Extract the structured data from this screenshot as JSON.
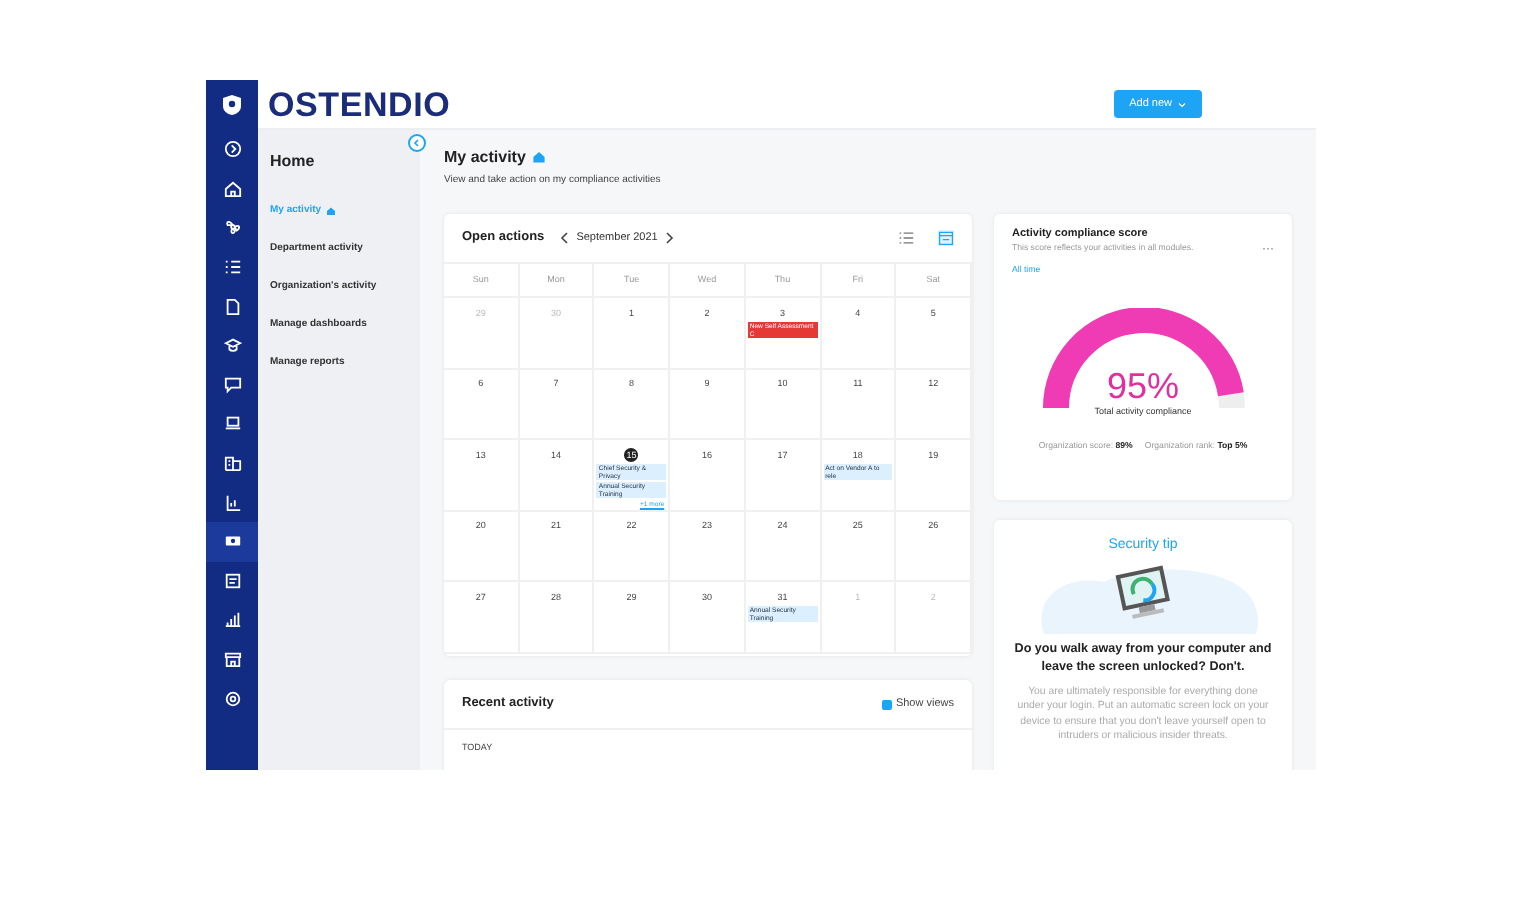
{
  "header": {
    "logo": "OSTENDIO",
    "add_button": "Add new"
  },
  "rail": [
    {
      "selected": false
    },
    {
      "selected": false
    },
    {
      "selected": false
    },
    {
      "selected": false
    },
    {
      "selected": false
    },
    {
      "selected": false
    },
    {
      "selected": false
    },
    {
      "selected": false
    },
    {
      "selected": false
    },
    {
      "selected": false
    },
    {
      "selected": true
    },
    {
      "selected": false
    },
    {
      "selected": false
    },
    {
      "selected": false
    },
    {
      "selected": false
    }
  ],
  "subnav": {
    "title": "Home",
    "items": [
      {
        "label": "My activity",
        "selected": true
      },
      {
        "label": "Department activity",
        "selected": false
      },
      {
        "label": "Organization's activity",
        "selected": false
      },
      {
        "label": "Manage dashboards",
        "selected": false
      },
      {
        "label": "Manage reports",
        "selected": false
      }
    ]
  },
  "page": {
    "title": "My activity",
    "subtitle": "View and take action on my compliance activities"
  },
  "calendar": {
    "title": "Open actions",
    "month": "September 2021",
    "views": [
      {
        "selected": false
      },
      {
        "selected": true
      }
    ],
    "weekdays": [
      "Sun",
      "Mon",
      "Tue",
      "Wed",
      "Thu",
      "Fri",
      "Sat"
    ],
    "weeks": [
      [
        {
          "day": "29",
          "muted": true,
          "today": false
        },
        {
          "day": "30",
          "muted": true,
          "today": false
        },
        {
          "day": "1",
          "muted": false,
          "today": false
        },
        {
          "day": "2",
          "muted": false,
          "today": false
        },
        {
          "day": "3",
          "muted": false,
          "today": false,
          "events": [
            {
              "title": "New Self Assessment C",
              "kind": "overdue"
            }
          ]
        },
        {
          "day": "4",
          "muted": false,
          "today": false
        },
        {
          "day": "5",
          "muted": false,
          "today": false
        }
      ],
      [
        {
          "day": "6",
          "muted": false,
          "today": false
        },
        {
          "day": "7",
          "muted": false,
          "today": false
        },
        {
          "day": "8",
          "muted": false,
          "today": false
        },
        {
          "day": "9",
          "muted": false,
          "today": false
        },
        {
          "day": "10",
          "muted": false,
          "today": false
        },
        {
          "day": "11",
          "muted": false,
          "today": false
        },
        {
          "day": "12",
          "muted": false,
          "today": false
        }
      ],
      [
        {
          "day": "13",
          "muted": false,
          "today": false
        },
        {
          "day": "14",
          "muted": false,
          "today": false
        },
        {
          "day": "15",
          "muted": false,
          "today": true,
          "events": [
            {
              "title": "Chief Security & Privacy",
              "kind": "upcoming"
            },
            {
              "title": "Annual Security Training",
              "kind": "upcoming"
            }
          ],
          "more": "+1 more"
        },
        {
          "day": "16",
          "muted": false,
          "today": false
        },
        {
          "day": "17",
          "muted": false,
          "today": false
        },
        {
          "day": "18",
          "muted": false,
          "today": false,
          "events": [
            {
              "title": "Act on Vendor A to rele",
              "kind": "upcoming"
            }
          ]
        },
        {
          "day": "19",
          "muted": false,
          "today": false
        }
      ],
      [
        {
          "day": "20",
          "muted": false,
          "today": false
        },
        {
          "day": "21",
          "muted": false,
          "today": false
        },
        {
          "day": "22",
          "muted": false,
          "today": false
        },
        {
          "day": "23",
          "muted": false,
          "today": false
        },
        {
          "day": "24",
          "muted": false,
          "today": false
        },
        {
          "day": "25",
          "muted": false,
          "today": false
        },
        {
          "day": "26",
          "muted": false,
          "today": false
        }
      ],
      [
        {
          "day": "27",
          "muted": false,
          "today": false
        },
        {
          "day": "28",
          "muted": false,
          "today": false
        },
        {
          "day": "29",
          "muted": false,
          "today": false
        },
        {
          "day": "30",
          "muted": false,
          "today": false
        },
        {
          "day": "31",
          "muted": false,
          "today": false,
          "events": [
            {
              "title": "Annual Security Training",
              "kind": "upcoming"
            }
          ]
        },
        {
          "day": "1",
          "muted": true,
          "today": false
        },
        {
          "day": "2",
          "muted": true,
          "today": false
        }
      ]
    ]
  },
  "recent": {
    "title": "Recent activity",
    "show_views": {
      "label": "Show views",
      "checked": true
    },
    "group": "TODAY"
  },
  "score": {
    "title": "Activity compliance score",
    "description": "This score reflects your activities in all modules.",
    "period": "All time",
    "menu": "···",
    "level": 0.95,
    "value": "95%",
    "caption": "Total activity compliance",
    "stats": [
      "Organization score: **89%**",
      "Organization rank: **Top 5%**"
    ]
  },
  "tip": {
    "title": "Security tip",
    "heading": "Do you walk away from your computer and leave the screen unlocked? Don't.",
    "body": "You are ultimately responsible for everything done under your login. Put an automatic screen lock on your device to ensure that you don't leave yourself open to intruders or malicious insider threats."
  }
}
